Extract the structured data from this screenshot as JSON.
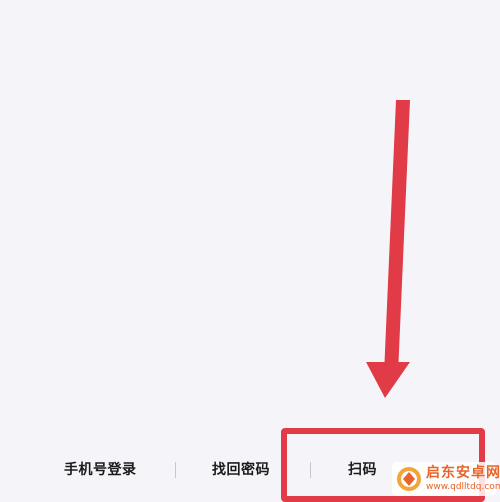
{
  "login_options": {
    "phone_login": "手机号登录",
    "find_password": "找回密码",
    "scan_login_partial": "扫码"
  },
  "watermark": {
    "site_name": "启东安卓网",
    "site_url": "www.qdlltdq.com",
    "logo_icon": "qidong-logo-icon"
  },
  "annotation": {
    "arrow_color": "#e03b47",
    "box_color": "#e03b47"
  },
  "colors": {
    "background": "#f5f5f9",
    "text": "#1a1a1a",
    "watermark": "#e8642b"
  }
}
